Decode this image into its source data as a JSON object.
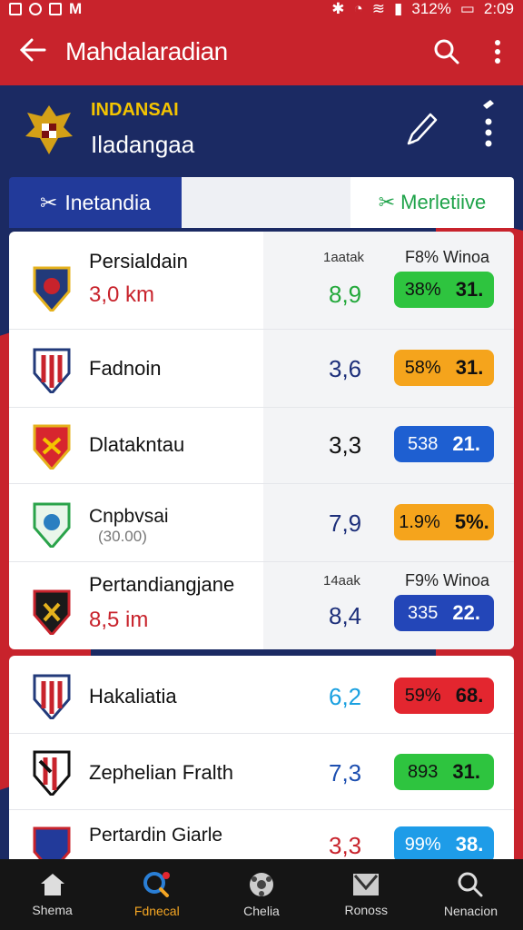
{
  "status_bar": {
    "battery": "312%",
    "time": "2:09"
  },
  "app_bar": {
    "title": "Mahdalaradian"
  },
  "header": {
    "brand": "INDANSAI",
    "subtitle": "Iladangaa"
  },
  "tabs": [
    {
      "label": "Inetandia",
      "icon": "swords-icon"
    },
    {
      "label": "Merletiive",
      "icon": "swords-icon"
    }
  ],
  "list_rows": [
    {
      "name": "Persialdain",
      "distance": "3,0 km",
      "col_header_1": "1aatak",
      "col_header_2": "F8% Winoa",
      "score": "8,9",
      "score_color": "#22a83a",
      "pill_left": "38%",
      "pill_right": "31.",
      "pill_color": "#2ec43f"
    },
    {
      "name": "Fadnoin",
      "score": "3,6",
      "score_color": "#1d2f7a",
      "pill_left": "58%",
      "pill_right": "31.",
      "pill_color": "#f5a41c"
    },
    {
      "name": "Dlatakntau",
      "score": "3,3",
      "score_color": "#111111",
      "pill_left": "538",
      "pill_right": "21.",
      "pill_color": "#1e5fd1"
    },
    {
      "name": "Cnpbvsai",
      "subnote": "(30.00)",
      "score": "7,9",
      "score_color": "#1d2f7a",
      "pill_left": "1.9%",
      "pill_right": "5%.",
      "pill_color": "#f5a41c"
    },
    {
      "name": "Pertandiangjane",
      "distance": "8,5 im",
      "col_header_1": "14aak",
      "col_header_2": "F9% Winoa",
      "score": "8,4",
      "score_color": "#1d2f7a",
      "pill_left": "335",
      "pill_right": "22.",
      "pill_color": "#2346b8"
    },
    {
      "name": "Hakaliatia",
      "score": "6,2",
      "score_color": "#1aa0e0",
      "pill_left": "59%",
      "pill_right": "68.",
      "pill_color": "#e3262f"
    },
    {
      "name": "Zephelian Fralth",
      "score": "7,3",
      "score_color": "#1d4fb0",
      "pill_left": "893",
      "pill_right": "31.",
      "pill_color": "#2ec43f"
    },
    {
      "name": "Pertardin Giarle",
      "score": "3,3",
      "score_color": "#c8232c",
      "pill_left": "99%",
      "pill_right": "38.",
      "pill_color": "#1e9ce8"
    }
  ],
  "bottom_nav": [
    {
      "label": "Shema",
      "icon": "home-icon"
    },
    {
      "label": "Fdnecal",
      "icon": "search-ball-icon",
      "active": true
    },
    {
      "label": "Chelia",
      "icon": "ball-icon"
    },
    {
      "label": "Ronoss",
      "icon": "mail-icon"
    },
    {
      "label": "Nenacion",
      "icon": "search-icon"
    }
  ]
}
